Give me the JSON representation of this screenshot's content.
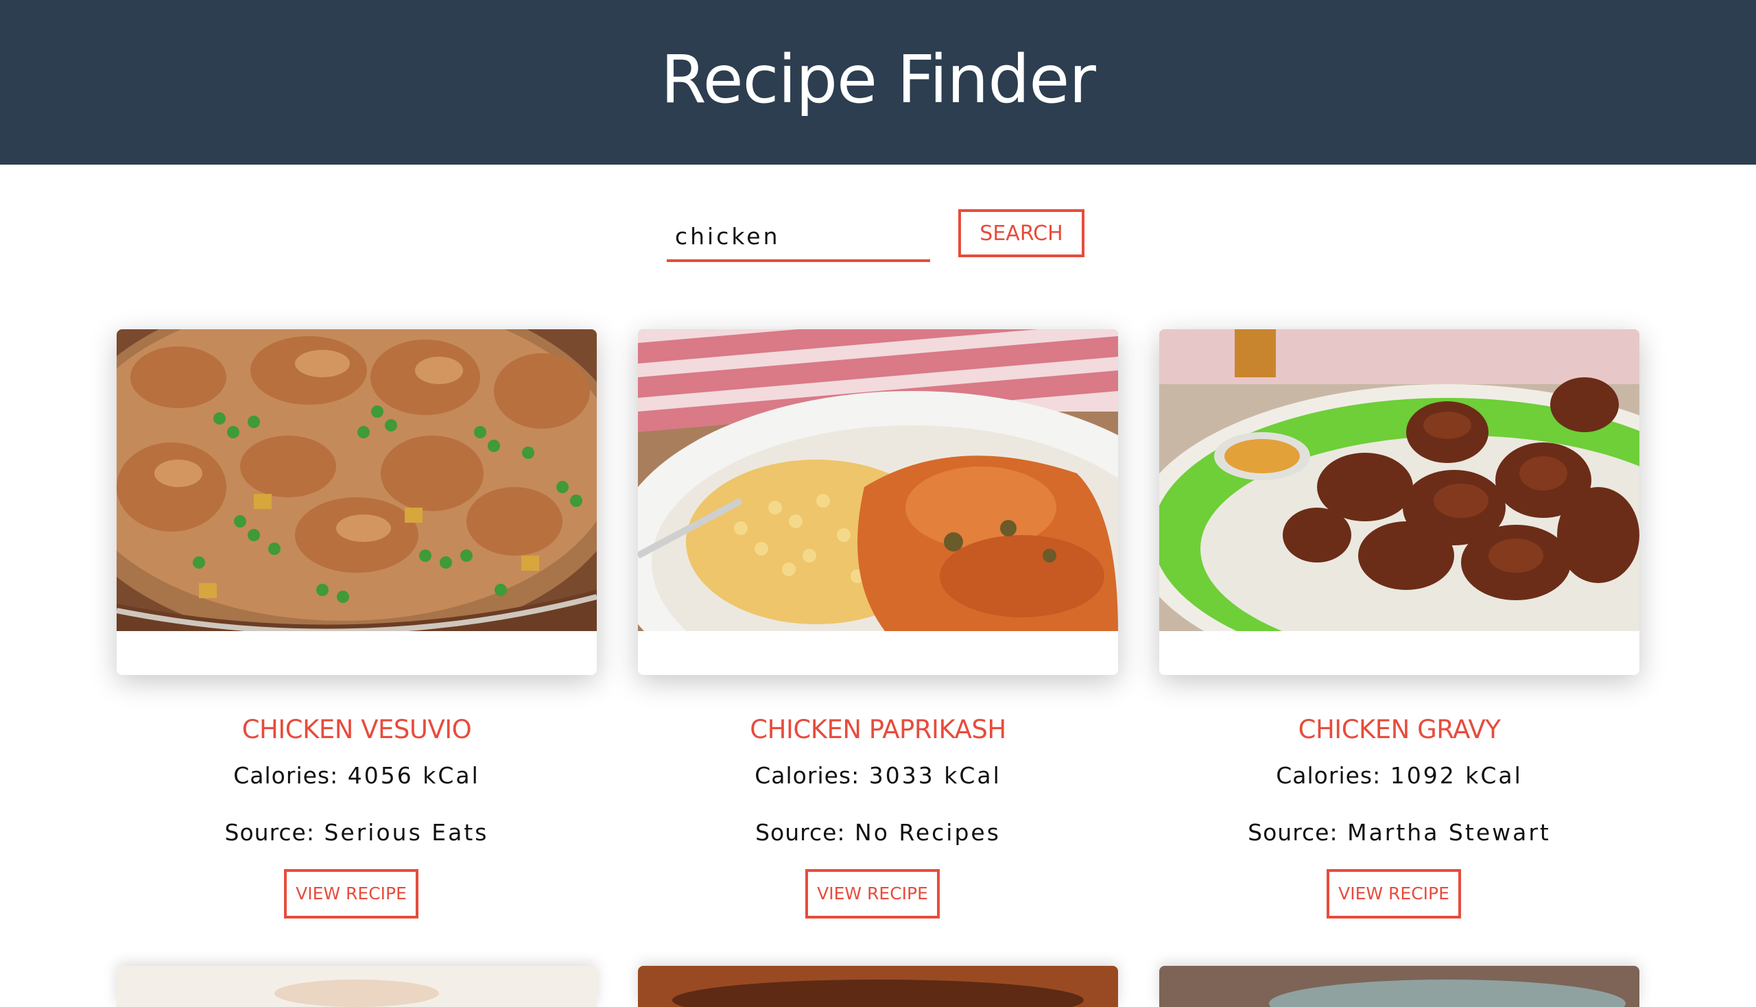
{
  "header": {
    "title": "Recipe Finder"
  },
  "search": {
    "value": "chicken",
    "button_label": "SEARCH"
  },
  "recipes": [
    {
      "title": "CHICKEN VESUVIO",
      "calories_label": "Calories:",
      "calories_value": "4056 kCal",
      "source_label": "Source:",
      "source_value": "Serious Eats",
      "button_label": "VIEW RECIPE"
    },
    {
      "title": "CHICKEN PAPRIKASH",
      "calories_label": "Calories:",
      "calories_value": "3033 kCal",
      "source_label": "Source:",
      "source_value": "No Recipes",
      "button_label": "VIEW RECIPE"
    },
    {
      "title": "CHICKEN GRAVY",
      "calories_label": "Calories:",
      "calories_value": "1092 kCal",
      "source_label": "Source:",
      "source_value": "Martha Stewart",
      "button_label": "VIEW RECIPE"
    }
  ],
  "colors": {
    "header_bg": "#2c3e50",
    "accent": "#e74c3c"
  }
}
